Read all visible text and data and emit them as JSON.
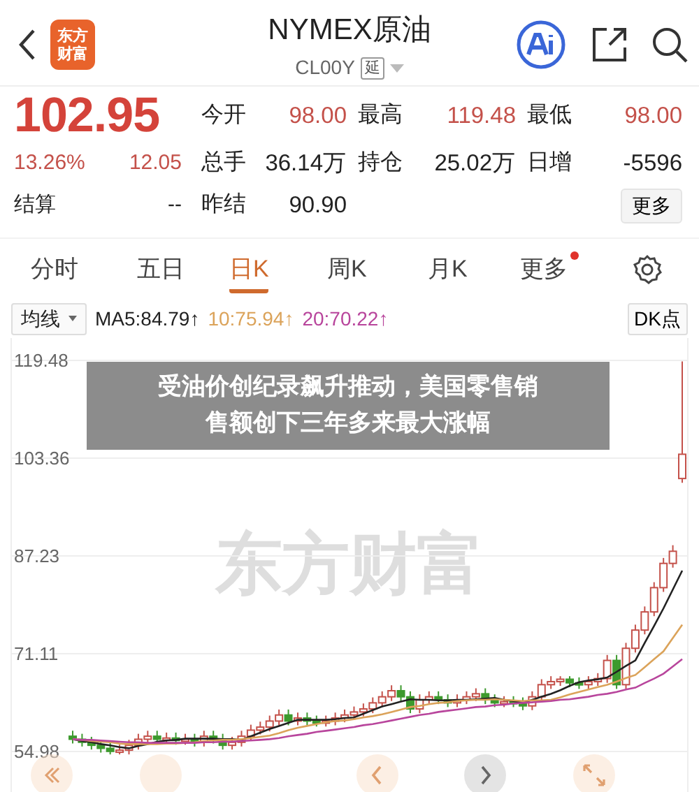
{
  "header": {
    "logo_lines": [
      "东方",
      "财富"
    ],
    "title": "NYMEX原油",
    "code": "CL00Y",
    "delay_tag": "延"
  },
  "quote": {
    "price": "102.95",
    "change_pct": "13.26%",
    "change": "12.05",
    "settle_label": "结算",
    "settle_value": "--",
    "stats": [
      {
        "label": "今开",
        "value": "98.00",
        "color": "#c4514a"
      },
      {
        "label": "最高",
        "value": "119.48",
        "color": "#c4514a"
      },
      {
        "label": "最低",
        "value": "98.00",
        "color": "#c4514a"
      },
      {
        "label": "总手",
        "value": "36.14万",
        "color": "#222222"
      },
      {
        "label": "持仓",
        "value": "25.02万",
        "color": "#222222"
      },
      {
        "label": "日增",
        "value": "-5596",
        "color": "#222222"
      },
      {
        "label": "昨结",
        "value": "90.90",
        "color": "#222222"
      }
    ],
    "more_button": "更多"
  },
  "tabs": [
    {
      "label": "分时",
      "selected": false,
      "dot": false
    },
    {
      "label": "五日",
      "selected": false,
      "dot": false
    },
    {
      "label": "日K",
      "selected": true,
      "dot": false
    },
    {
      "label": "周K",
      "selected": false,
      "dot": false
    },
    {
      "label": "月K",
      "selected": false,
      "dot": false
    },
    {
      "label": "更多",
      "selected": false,
      "dot": true
    }
  ],
  "ma_bar": {
    "select": "均线",
    "averages": [
      {
        "text": "MA5:84.79↑",
        "color": "#222222"
      },
      {
        "text": "10:75.94↑",
        "color": "#dba35a"
      },
      {
        "text": "20:70.22↑",
        "color": "#b8459c"
      }
    ],
    "dk_button": "DK点"
  },
  "chart": {
    "watermark": "东方财富",
    "chart_data": {
      "type": "candlestick",
      "ylim": [
        54.98,
        119.48
      ],
      "yticks": [
        54.98,
        71.11,
        87.23,
        103.36,
        119.48
      ],
      "grid": true,
      "ohlc": [
        [
          57.5,
          58.4,
          56.3,
          57
        ],
        [
          57,
          57.9,
          55.8,
          56.5
        ],
        [
          56.5,
          57.4,
          55.3,
          56
        ],
        [
          56,
          56.9,
          54.8,
          55.5
        ],
        [
          55.5,
          56.4,
          54.5,
          55
        ],
        [
          55,
          56.1,
          54.5,
          55.2
        ],
        [
          55.2,
          56.9,
          54.5,
          56
        ],
        [
          56,
          57.9,
          55.3,
          57
        ],
        [
          57,
          58.4,
          56.3,
          57.5
        ],
        [
          57.5,
          58.4,
          56.3,
          57
        ],
        [
          57,
          58.1,
          56.3,
          57.2
        ],
        [
          57.2,
          58.1,
          56.1,
          56.8
        ],
        [
          56.8,
          57.9,
          56.1,
          57
        ],
        [
          57,
          57.9,
          55.8,
          56.5
        ],
        [
          56.5,
          58.4,
          55.8,
          57.5
        ],
        [
          57.5,
          58.4,
          56.3,
          57
        ],
        [
          57,
          57.9,
          55.3,
          56
        ],
        [
          56,
          57.4,
          55.3,
          56.5
        ],
        [
          56.5,
          58.4,
          55.8,
          57.5
        ],
        [
          57.5,
          59.4,
          56.8,
          58.5
        ],
        [
          58.5,
          59.9,
          57.8,
          59
        ],
        [
          59,
          60.9,
          58.3,
          60
        ],
        [
          60,
          61.9,
          59.3,
          61
        ],
        [
          61,
          61.9,
          59.3,
          60
        ],
        [
          60,
          61.4,
          59.3,
          60.5
        ],
        [
          60.5,
          61.4,
          59.3,
          60
        ],
        [
          60,
          60.9,
          59.1,
          59.8
        ],
        [
          59.8,
          60.9,
          59.1,
          60
        ],
        [
          60,
          61.4,
          59.3,
          60.5
        ],
        [
          60.5,
          61.9,
          59.8,
          61
        ],
        [
          61,
          62.4,
          60.3,
          61.5
        ],
        [
          61.5,
          62.9,
          60.8,
          62
        ],
        [
          62,
          63.9,
          61.3,
          63
        ],
        [
          63,
          64.9,
          62.3,
          64
        ],
        [
          64,
          65.9,
          63.3,
          65
        ],
        [
          65,
          65.9,
          63.3,
          64
        ],
        [
          64,
          64.9,
          61.3,
          62
        ],
        [
          62,
          64.4,
          61.3,
          63.5
        ],
        [
          63.5,
          64.9,
          62.8,
          64
        ],
        [
          64,
          64.9,
          62.8,
          63.5
        ],
        [
          63.5,
          64.4,
          62.3,
          63
        ],
        [
          63,
          64.4,
          62.3,
          63.5
        ],
        [
          63.5,
          64.9,
          62.8,
          64
        ],
        [
          64,
          65.4,
          63.3,
          64.5
        ],
        [
          64.5,
          65.4,
          62.8,
          63.5
        ],
        [
          63.5,
          64.4,
          62.3,
          63
        ],
        [
          63,
          64.1,
          62.3,
          63.2
        ],
        [
          63.2,
          64.1,
          62.3,
          63
        ],
        [
          63,
          63.9,
          61.8,
          62.5
        ],
        [
          62.5,
          64.9,
          61.8,
          64
        ],
        [
          64,
          66.9,
          63.3,
          66
        ],
        [
          66,
          67.4,
          65.3,
          66.5
        ],
        [
          66.5,
          67.4,
          65.8,
          66.9
        ],
        [
          66.9,
          67.4,
          65.6,
          66.3
        ],
        [
          66.3,
          67.2,
          65.3,
          66
        ],
        [
          66,
          67.4,
          65.3,
          66.5
        ],
        [
          66.5,
          67.9,
          65.8,
          67
        ],
        [
          67,
          70.9,
          66.3,
          70
        ],
        [
          70,
          70.9,
          65.3,
          66
        ],
        [
          66,
          72.9,
          65.3,
          72
        ],
        [
          72,
          75.9,
          71.3,
          75
        ],
        [
          75,
          78.9,
          74.3,
          78
        ],
        [
          78,
          82.9,
          77.3,
          82
        ],
        [
          82,
          86.9,
          81.3,
          86
        ],
        [
          86,
          89,
          85.3,
          88
        ],
        [
          100,
          119.3,
          99.3,
          104
        ]
      ],
      "series": [
        {
          "type": "line",
          "color": "#222222",
          "values": [
            57,
            56.7,
            56.5,
            56.2,
            56.0,
            55.7,
            55.5,
            55.9,
            56.2,
            56.6,
            56.8,
            56.9,
            57.1,
            57.1,
            57.1,
            57.1,
            57.0,
            57.0,
            56.9,
            57.5,
            58.1,
            58.7,
            59.2,
            59.7,
            60.2,
            60.2,
            60.2,
            60.2,
            60.3,
            60.5,
            60.6,
            61.2,
            61.8,
            62.4,
            62.8,
            63.2,
            63.6,
            63.5,
            63.5,
            63.4,
            63.4,
            63.5,
            63.5,
            63.6,
            63.7,
            63.8,
            63.5,
            63.3,
            63.0,
            63.5,
            64.0,
            64.5,
            65.1,
            65.8,
            66.4,
            66.7,
            66.9,
            67.2,
            68.1,
            69.1,
            70.0,
            72.9,
            75.7,
            78.6,
            81.7,
            84.8
          ]
        },
        {
          "type": "line",
          "color": "#dba35a",
          "values": [
            57,
            56.9,
            56.7,
            56.6,
            56.5,
            56.3,
            56.2,
            56.2,
            56.2,
            56.2,
            56.3,
            56.3,
            56.4,
            56.5,
            56.7,
            56.8,
            56.9,
            56.9,
            57.0,
            57.2,
            57.4,
            57.6,
            58.0,
            58.5,
            58.9,
            59.2,
            59.5,
            59.8,
            60.0,
            60.1,
            60.3,
            60.6,
            60.8,
            61.1,
            61.5,
            61.9,
            62.3,
            62.5,
            62.8,
            63.0,
            63.1,
            63.3,
            63.4,
            63.5,
            63.5,
            63.6,
            63.5,
            63.4,
            63.3,
            63.4,
            63.4,
            63.5,
            63.9,
            64.4,
            64.8,
            65.2,
            65.6,
            66.0,
            66.5,
            67.1,
            67.6,
            68.9,
            70.2,
            71.5,
            73.7,
            75.9
          ]
        },
        {
          "type": "line",
          "color": "#b8459c",
          "values": [
            57,
            56.9,
            56.9,
            56.8,
            56.7,
            56.6,
            56.5,
            56.5,
            56.4,
            56.4,
            56.4,
            56.4,
            56.4,
            56.4,
            56.5,
            56.5,
            56.6,
            56.6,
            56.7,
            56.8,
            56.9,
            57.0,
            57.2,
            57.5,
            57.7,
            57.9,
            58.2,
            58.4,
            58.6,
            58.8,
            59.0,
            59.3,
            59.5,
            59.8,
            60.1,
            60.4,
            60.7,
            61.0,
            61.2,
            61.5,
            61.7,
            61.9,
            62.1,
            62.3,
            62.4,
            62.6,
            62.7,
            62.9,
            63.0,
            63.1,
            63.2,
            63.3,
            63.5,
            63.6,
            63.8,
            64.0,
            64.3,
            64.5,
            64.8,
            65.2,
            65.5,
            66.3,
            67.0,
            67.8,
            69.0,
            70.2
          ]
        }
      ]
    },
    "nav_buttons": [
      {
        "kind": "rewind"
      },
      {
        "kind": "blank"
      },
      {
        "kind": "prev"
      },
      {
        "kind": "next"
      },
      {
        "kind": "expand"
      }
    ]
  },
  "caption": {
    "lines": [
      "受油价创纪录飙升推动，美国零售销",
      "售额创下三年多来最大涨幅"
    ]
  }
}
